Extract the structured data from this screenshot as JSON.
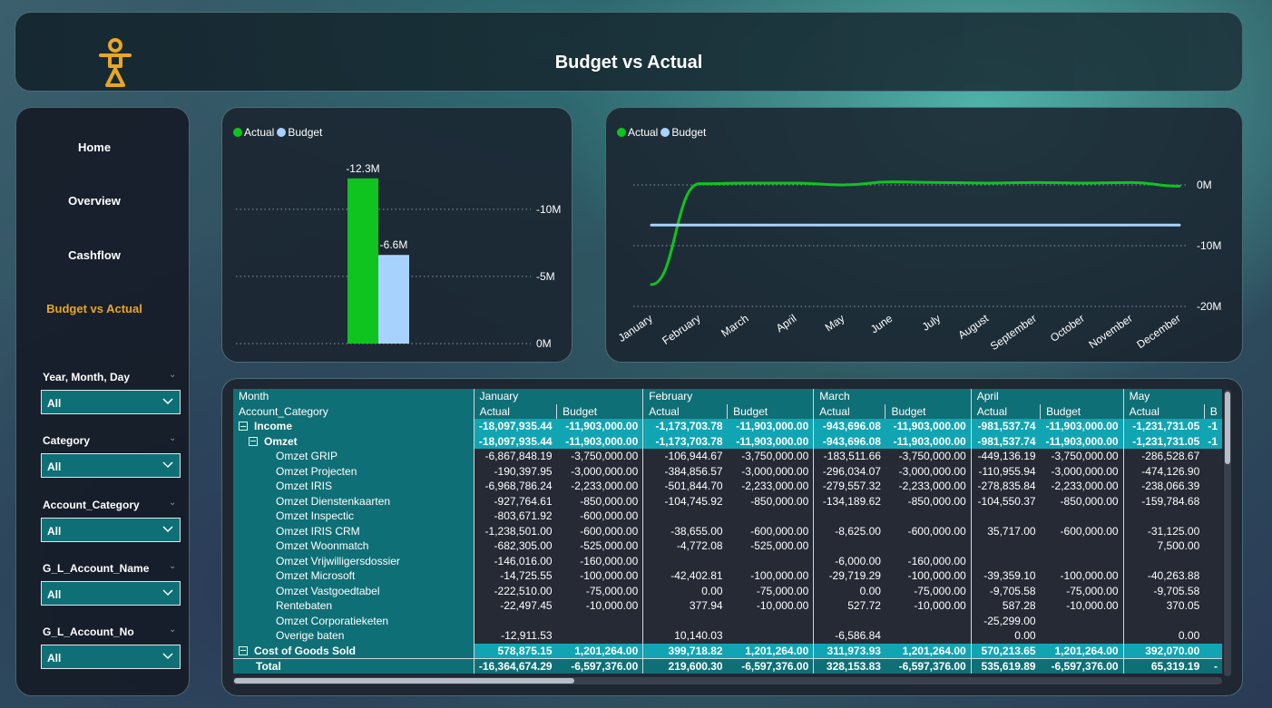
{
  "header": {
    "title": "Budget vs Actual",
    "logo": "company-logo"
  },
  "nav": {
    "home": "Home",
    "overview": "Overview",
    "cashflow": "Cashflow",
    "budget": "Budget vs Actual"
  },
  "filters": [
    {
      "label": "Year, Month, Day",
      "value": "All"
    },
    {
      "label": "Category",
      "value": "All"
    },
    {
      "label": "Account_Category",
      "value": "All"
    },
    {
      "label": "G_L_Account_Name",
      "value": "All"
    },
    {
      "label": "G_L_Account_No",
      "value": "All"
    }
  ],
  "colors": {
    "actual": "#0fc41f",
    "budget": "#a8d2fe",
    "accent": "#e8a624",
    "teal": "#0f6f76",
    "highlight": "#11a5b3"
  },
  "chart_data": [
    {
      "type": "bar",
      "legend": [
        "Actual",
        "Budget"
      ],
      "categories": [
        ""
      ],
      "series": [
        {
          "name": "Actual",
          "values": [
            -12.3
          ]
        },
        {
          "name": "Budget",
          "values": [
            -6.6
          ]
        }
      ],
      "data_labels": [
        "-12.3M",
        "-6.6M"
      ],
      "yticks": [
        "-10M",
        "-5M",
        "0M"
      ],
      "ylim": [
        0,
        -13.5
      ],
      "grid": true,
      "legend_position": "top-left"
    },
    {
      "type": "line",
      "legend": [
        "Actual",
        "Budget"
      ],
      "categories": [
        "January",
        "February",
        "March",
        "April",
        "May",
        "June",
        "July",
        "August",
        "September",
        "October",
        "November",
        "December"
      ],
      "series": [
        {
          "name": "Actual",
          "values": [
            -16.4,
            0.2,
            0.3,
            0.3,
            0.0,
            0.5,
            0.4,
            0.3,
            0.4,
            0.3,
            0.4,
            -0.2
          ]
        },
        {
          "name": "Budget",
          "values": [
            -6.6,
            -6.6,
            -6.6,
            -6.6,
            -6.6,
            -6.6,
            -6.6,
            -6.6,
            -6.6,
            -6.6,
            -6.6,
            -6.6
          ]
        }
      ],
      "yticks": [
        "0M",
        "-10M",
        "-20M"
      ],
      "ylim": [
        2,
        -20
      ],
      "grid": true,
      "legend_position": "top-left"
    }
  ],
  "matrix": {
    "col_header_row1": "Month",
    "col_header_row2": "Account_Category",
    "months": [
      "January",
      "February",
      "March",
      "April",
      "May"
    ],
    "partial_col": "B",
    "subcols": [
      "Actual",
      "Budget"
    ],
    "rows": [
      {
        "label": "Income",
        "level": 0,
        "expander": true,
        "cells": [
          "-18,097,935.44",
          "-11,903,000.00",
          "-1,173,703.78",
          "-11,903,000.00",
          "-943,696.08",
          "-11,903,000.00",
          "-981,537.74",
          "-11,903,000.00",
          "-1,231,731.05",
          "-1"
        ]
      },
      {
        "label": "Omzet",
        "level": 1,
        "expander": true,
        "cells": [
          "-18,097,935.44",
          "-11,903,000.00",
          "-1,173,703.78",
          "-11,903,000.00",
          "-943,696.08",
          "-11,903,000.00",
          "-981,537.74",
          "-11,903,000.00",
          "-1,231,731.05",
          "-1"
        ]
      },
      {
        "label": "Omzet GRIP",
        "level": 2,
        "cells": [
          "-6,867,848.19",
          "-3,750,000.00",
          "-106,944.67",
          "-3,750,000.00",
          "-183,511.66",
          "-3,750,000.00",
          "-449,136.19",
          "-3,750,000.00",
          "-286,528.67",
          ""
        ]
      },
      {
        "label": "Omzet Projecten",
        "level": 2,
        "cells": [
          "-190,397.95",
          "-3,000,000.00",
          "-384,856.57",
          "-3,000,000.00",
          "-296,034.07",
          "-3,000,000.00",
          "-110,955.94",
          "-3,000,000.00",
          "-474,126.90",
          ""
        ]
      },
      {
        "label": "Omzet IRIS",
        "level": 2,
        "cells": [
          "-6,968,786.24",
          "-2,233,000.00",
          "-501,844.70",
          "-2,233,000.00",
          "-279,557.32",
          "-2,233,000.00",
          "-278,835.84",
          "-2,233,000.00",
          "-238,066.39",
          ""
        ]
      },
      {
        "label": "Omzet Dienstenkaarten",
        "level": 2,
        "cells": [
          "-927,764.61",
          "-850,000.00",
          "-104,745.92",
          "-850,000.00",
          "-134,189.62",
          "-850,000.00",
          "-104,550.37",
          "-850,000.00",
          "-159,784.68",
          ""
        ]
      },
      {
        "label": "Omzet Inspectic",
        "level": 2,
        "cells": [
          "-803,671.92",
          "-600,000.00",
          "",
          "",
          "",
          "",
          "",
          "",
          "",
          ""
        ]
      },
      {
        "label": "Omzet IRIS CRM",
        "level": 2,
        "cells": [
          "-1,238,501.00",
          "-600,000.00",
          "-38,655.00",
          "-600,000.00",
          "-8,625.00",
          "-600,000.00",
          "35,717.00",
          "-600,000.00",
          "-31,125.00",
          ""
        ]
      },
      {
        "label": "Omzet Woonmatch",
        "level": 2,
        "cells": [
          "-682,305.00",
          "-525,000.00",
          "-4,772.08",
          "-525,000.00",
          "",
          "",
          "",
          "",
          "7,500.00",
          ""
        ]
      },
      {
        "label": "Omzet Vrijwilligersdossier",
        "level": 2,
        "cells": [
          "-146,016.00",
          "-160,000.00",
          "",
          "",
          "-6,000.00",
          "-160,000.00",
          "",
          "",
          "",
          ""
        ]
      },
      {
        "label": "Omzet Microsoft",
        "level": 2,
        "cells": [
          "-14,725.55",
          "-100,000.00",
          "-42,402.81",
          "-100,000.00",
          "-29,719.29",
          "-100,000.00",
          "-39,359.10",
          "-100,000.00",
          "-40,263.88",
          ""
        ]
      },
      {
        "label": "Omzet Vastgoedtabel",
        "level": 2,
        "cells": [
          "-222,510.00",
          "-75,000.00",
          "0.00",
          "-75,000.00",
          "0.00",
          "-75,000.00",
          "-9,705.58",
          "-75,000.00",
          "-9,705.58",
          ""
        ]
      },
      {
        "label": "Rentebaten",
        "level": 2,
        "cells": [
          "-22,497.45",
          "-10,000.00",
          "377.94",
          "-10,000.00",
          "527.72",
          "-10,000.00",
          "587.28",
          "-10,000.00",
          "370.05",
          ""
        ]
      },
      {
        "label": "Omzet Corporatieketen",
        "level": 2,
        "cells": [
          "",
          "",
          "",
          "",
          "",
          "",
          "-25,299.00",
          "",
          "",
          ""
        ]
      },
      {
        "label": "Overige baten",
        "level": 2,
        "cells": [
          "-12,911.53",
          "",
          "10,140.03",
          "",
          "-6,586.84",
          "",
          "0.00",
          "",
          "0.00",
          ""
        ]
      },
      {
        "label": "Cost of Goods Sold",
        "level": 0,
        "expander": true,
        "cells": [
          "578,875.15",
          "1,201,264.00",
          "399,718.82",
          "1,201,264.00",
          "311,973.93",
          "1,201,264.00",
          "570,213.65",
          "1,201,264.00",
          "392,070.00",
          ""
        ]
      }
    ],
    "total": {
      "label": "Total",
      "cells": [
        "-16,364,674.29",
        "-6,597,376.00",
        "219,600.30",
        "-6,597,376.00",
        "328,153.83",
        "-6,597,376.00",
        "535,619.89",
        "-6,597,376.00",
        "65,319.19",
        "-"
      ]
    }
  }
}
